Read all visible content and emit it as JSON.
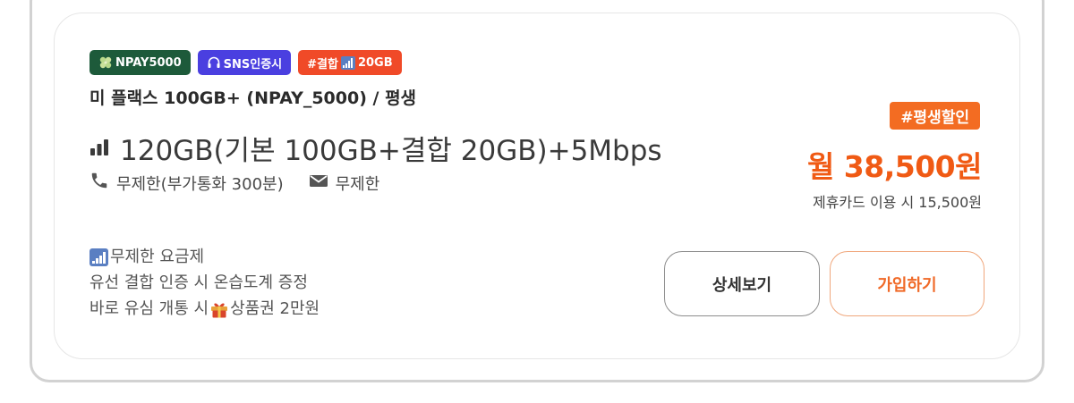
{
  "badges": {
    "npay_label": "NPAY5000",
    "sns_label": "SNS인증시",
    "combo_label_prefix": "#결합",
    "combo_label_suffix": "20GB"
  },
  "plan": {
    "name": "미 플랙스 100GB+ (NPAY_5000) / 평생",
    "data": "120GB(기본 100GB+결합 20GB)+5Mbps",
    "voice": "무제한(부가통화 300분)",
    "sms": "무제한"
  },
  "benefits": {
    "line1": "무제한 요금제",
    "line2": "유선 결합 인증 시 온습도계 증정",
    "line3_prefix": "바로 유심 개통 시",
    "line3_suffix": "상품권 2만원"
  },
  "pricing": {
    "promo": "#평생할인",
    "price": "월 38,500원",
    "card_discount": "제휴카드 이용 시 15,500원"
  },
  "buttons": {
    "detail": "상세보기",
    "join": "가입하기"
  },
  "colors": {
    "accent": "#f05a14",
    "npay_badge": "#1d5a3a",
    "sns_badge": "#4a3fe0",
    "combo_badge": "#f04a28"
  },
  "icons": [
    "clover-icon",
    "headset-icon",
    "signal-icon",
    "phone-icon",
    "mail-icon",
    "gift-icon"
  ]
}
